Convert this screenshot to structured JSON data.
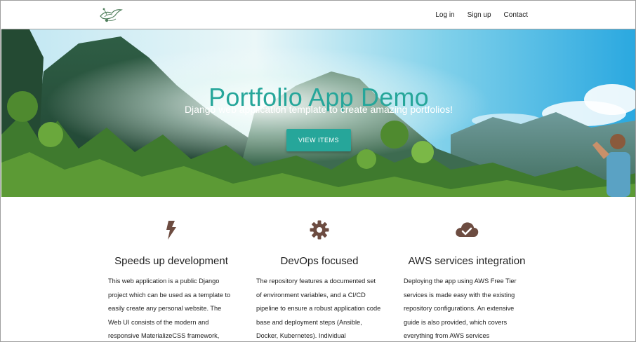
{
  "nav": {
    "links": [
      "Log in",
      "Sign up",
      "Contact"
    ],
    "logo_icon": "bird-logo-icon"
  },
  "hero": {
    "title": "Portfolio App Demo",
    "subtitle": "Django web application template to create amazing portfolios!",
    "button_label": "VIEW ITEMS"
  },
  "features": [
    {
      "icon": "bolt-icon",
      "title": "Speeds up development",
      "text": "This web application is a public Django project which can be used as a template to easily create any personal website. The Web UI consists of the modern and responsive MaterializeCSS framework,"
    },
    {
      "icon": "gear-icon",
      "title": "DevOps focused",
      "text": "The repository features a documented set of environment variables, and a CI/CD pipeline to ensure a robust application code base and deployment steps (Ansible, Docker, Kubernetes). Individual"
    },
    {
      "icon": "cloud-check-icon",
      "title": "AWS services integration",
      "text": "Deploying the app using AWS Free Tier services is made easy with the existing repository configurations. An extensive guide is also provided, which covers everything from AWS services"
    }
  ],
  "colors": {
    "accent": "#26a69a",
    "icon": "#6d4c41"
  }
}
